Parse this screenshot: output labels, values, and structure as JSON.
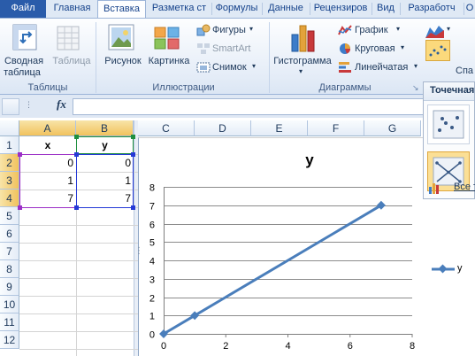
{
  "tabs": [
    "Файл",
    "Главная",
    "Вставка",
    "Разметка ст",
    "Формулы",
    "Данные",
    "Рецензиров",
    "Вид",
    "Разработч",
    "О"
  ],
  "active_tab": "Вставка",
  "ribbon": {
    "tables": {
      "group_label": "Таблицы",
      "pivot_line1": "Сводная",
      "pivot_line2": "таблица",
      "table": "Таблица"
    },
    "illustrations": {
      "group_label": "Иллюстрации",
      "picture": "Рисунок",
      "clipart": "Картинка",
      "shapes": "Фигуры",
      "smartart": "SmartArt",
      "screenshot": "Снимок"
    },
    "charts": {
      "group_label": "Диаграммы",
      "histogram": "Гистограмма",
      "line": "График",
      "pie": "Круговая",
      "bar": "Линейчатая",
      "cut": "Спа"
    }
  },
  "formula_bar": {
    "fx": "fx",
    "value": ""
  },
  "sheet": {
    "columns": [
      "A",
      "B",
      "C",
      "D",
      "E",
      "F",
      "G"
    ],
    "rows": [
      "1",
      "2",
      "3",
      "4",
      "5",
      "6",
      "7",
      "8",
      "9",
      "10",
      "11",
      "12"
    ],
    "cells": {
      "A1": "x",
      "B1": "y",
      "A2": "0",
      "B2": "0",
      "A3": "1",
      "B3": "1",
      "A4": "7",
      "B4": "7"
    }
  },
  "chart_data": {
    "type": "scatter",
    "title": "y",
    "series": [
      {
        "name": "y",
        "x": [
          0,
          1,
          7
        ],
        "y": [
          0,
          1,
          7
        ],
        "color": "#4a7ebb"
      }
    ],
    "xlim": [
      0,
      8
    ],
    "ylim": [
      0,
      8
    ],
    "x_ticks": [
      "0",
      "2",
      "4",
      "6",
      "8"
    ],
    "y_ticks": [
      "0",
      "1",
      "2",
      "3",
      "4",
      "5",
      "6",
      "7",
      "8"
    ],
    "grid": true,
    "legend": "right"
  },
  "dropdown": {
    "header": "Точечная",
    "all_types": "Все т"
  },
  "colors": {
    "file_tab": "#2a5caa",
    "series": "#4a7ebb",
    "selection": "#f1c25e"
  }
}
